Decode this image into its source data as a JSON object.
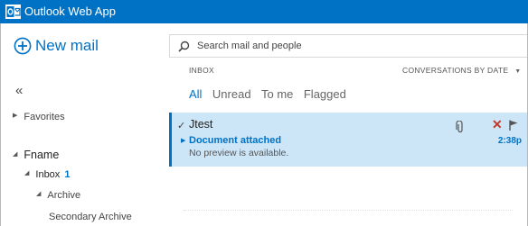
{
  "app": {
    "title": "Outlook Web App"
  },
  "left_pane": {
    "new_mail_label": "New mail",
    "collapse_glyph": "«",
    "favorites_label": "Favorites",
    "mailbox_label": "Fname",
    "inbox": {
      "label": "Inbox",
      "count": "1"
    },
    "archive_label": "Archive",
    "secondary_archive_label": "Secondary Archive"
  },
  "search": {
    "placeholder": "Search mail and people"
  },
  "list_header": {
    "folder": "INBOX",
    "sort_label": "CONVERSATIONS BY DATE"
  },
  "filters": [
    "All",
    "Unread",
    "To me",
    "Flagged"
  ],
  "active_filter": "All",
  "messages": [
    {
      "sender": "Jtest",
      "subject": "Document attached",
      "preview": "No preview is available.",
      "time": "2:38p",
      "has_attachment": true,
      "selected": true
    }
  ],
  "colors": {
    "accent": "#0072c6",
    "selected_bg": "#cde6f7",
    "delete": "#c0392b"
  },
  "icons": [
    "outlook-logo-icon",
    "plus-circle-icon",
    "search-icon",
    "paperclip-icon",
    "delete-icon",
    "flag-icon"
  ]
}
